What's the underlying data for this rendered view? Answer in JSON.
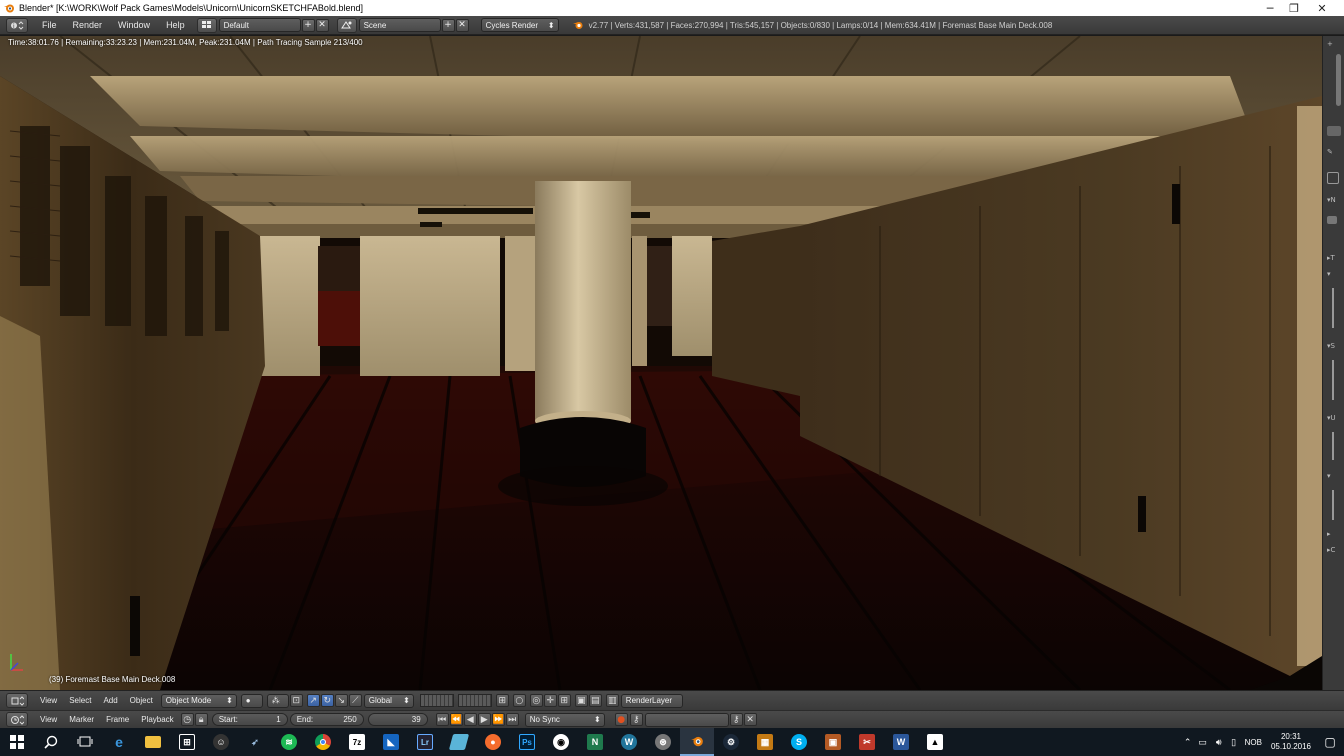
{
  "window": {
    "title": "Blender* [K:\\WORK\\Wolf Pack Games\\Models\\Unicorn\\UnicornSKETCHFABold.blend]",
    "controls": {
      "minimize": "─",
      "maximize": "❐",
      "close": "✕"
    }
  },
  "info_header": {
    "menus": [
      "File",
      "Render",
      "Window",
      "Help"
    ],
    "screen_layout": "Default",
    "scene": "Scene",
    "render_engine": "Cycles Render",
    "stats": "v2.77 | Verts:431,587 | Faces:270,994 | Tris:545,157 | Objects:0/830 | Lamps:0/14 | Mem:634.41M | Foremast Base Main Deck.008"
  },
  "viewport": {
    "render_status": "Time:38:01.76 | Remaining:33:23.23 | Mem:231.04M, Peak:231.04M | Path Tracing Sample 213/400",
    "object_label": "(39) Foremast Base Main Deck.008"
  },
  "view3d_header": {
    "menus": [
      "View",
      "Select",
      "Add",
      "Object"
    ],
    "mode": "Object Mode",
    "orientation": "Global",
    "render_layer": "RenderLayer"
  },
  "timeline_header": {
    "menus": [
      "View",
      "Marker",
      "Frame",
      "Playback"
    ],
    "start_label": "Start:",
    "start_value": "1",
    "end_label": "End:",
    "end_value": "250",
    "current_frame": "39",
    "sync": "No Sync"
  },
  "taskbar": {
    "icons": [
      "windows-start",
      "search",
      "task-view",
      "edge",
      "file-explorer",
      "store",
      "person",
      "feather",
      "spotify",
      "chrome",
      "7zip",
      "vpn",
      "lightroom",
      "cube",
      "origin",
      "photoshop",
      "eye",
      "notepad-n",
      "wordpress",
      "steering",
      "blender",
      "steam",
      "grid-app",
      "skype",
      "game-app",
      "tool-app",
      "word",
      "photos"
    ],
    "tray_lang": "NOB",
    "time": "20:31",
    "date": "05.10.2016"
  },
  "colors": {
    "blender_orange": "#e87d0d",
    "header_grey": "#404040",
    "active_blue": "#5680c2",
    "taskbar_bg": "#101820"
  }
}
